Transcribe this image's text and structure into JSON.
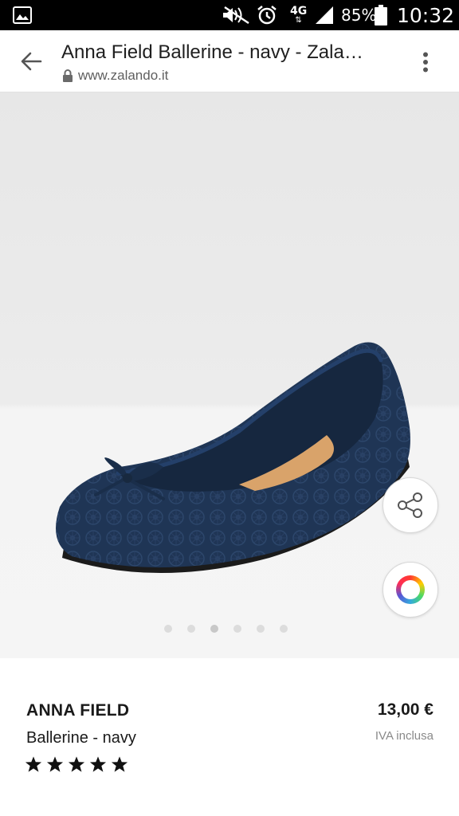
{
  "status_bar": {
    "battery": "85%",
    "network": "4G",
    "time": "10:32",
    "icons": [
      "gallery-icon",
      "mute-icon",
      "alarm-icon",
      "signal-icon",
      "battery-icon"
    ]
  },
  "browser": {
    "title": "Anna Field Ballerine - navy - Zala…",
    "url": "www.zalando.it",
    "icons": [
      "back-arrow-icon",
      "lock-icon",
      "more-vert-icon"
    ]
  },
  "gallery": {
    "dot_count": 6,
    "active_index": 2,
    "icons": [
      "share-icon",
      "color-wheel-icon"
    ]
  },
  "product": {
    "brand": "ANNA FIELD",
    "name": "Ballerine - navy",
    "price": "13,00 €",
    "vat_note": "IVA inclusa",
    "rating": 5,
    "rating_max": 5
  },
  "colors": {
    "shoe_navy": "#1f3555",
    "text": "#1a1a1a",
    "muted": "#8a8a8a"
  }
}
